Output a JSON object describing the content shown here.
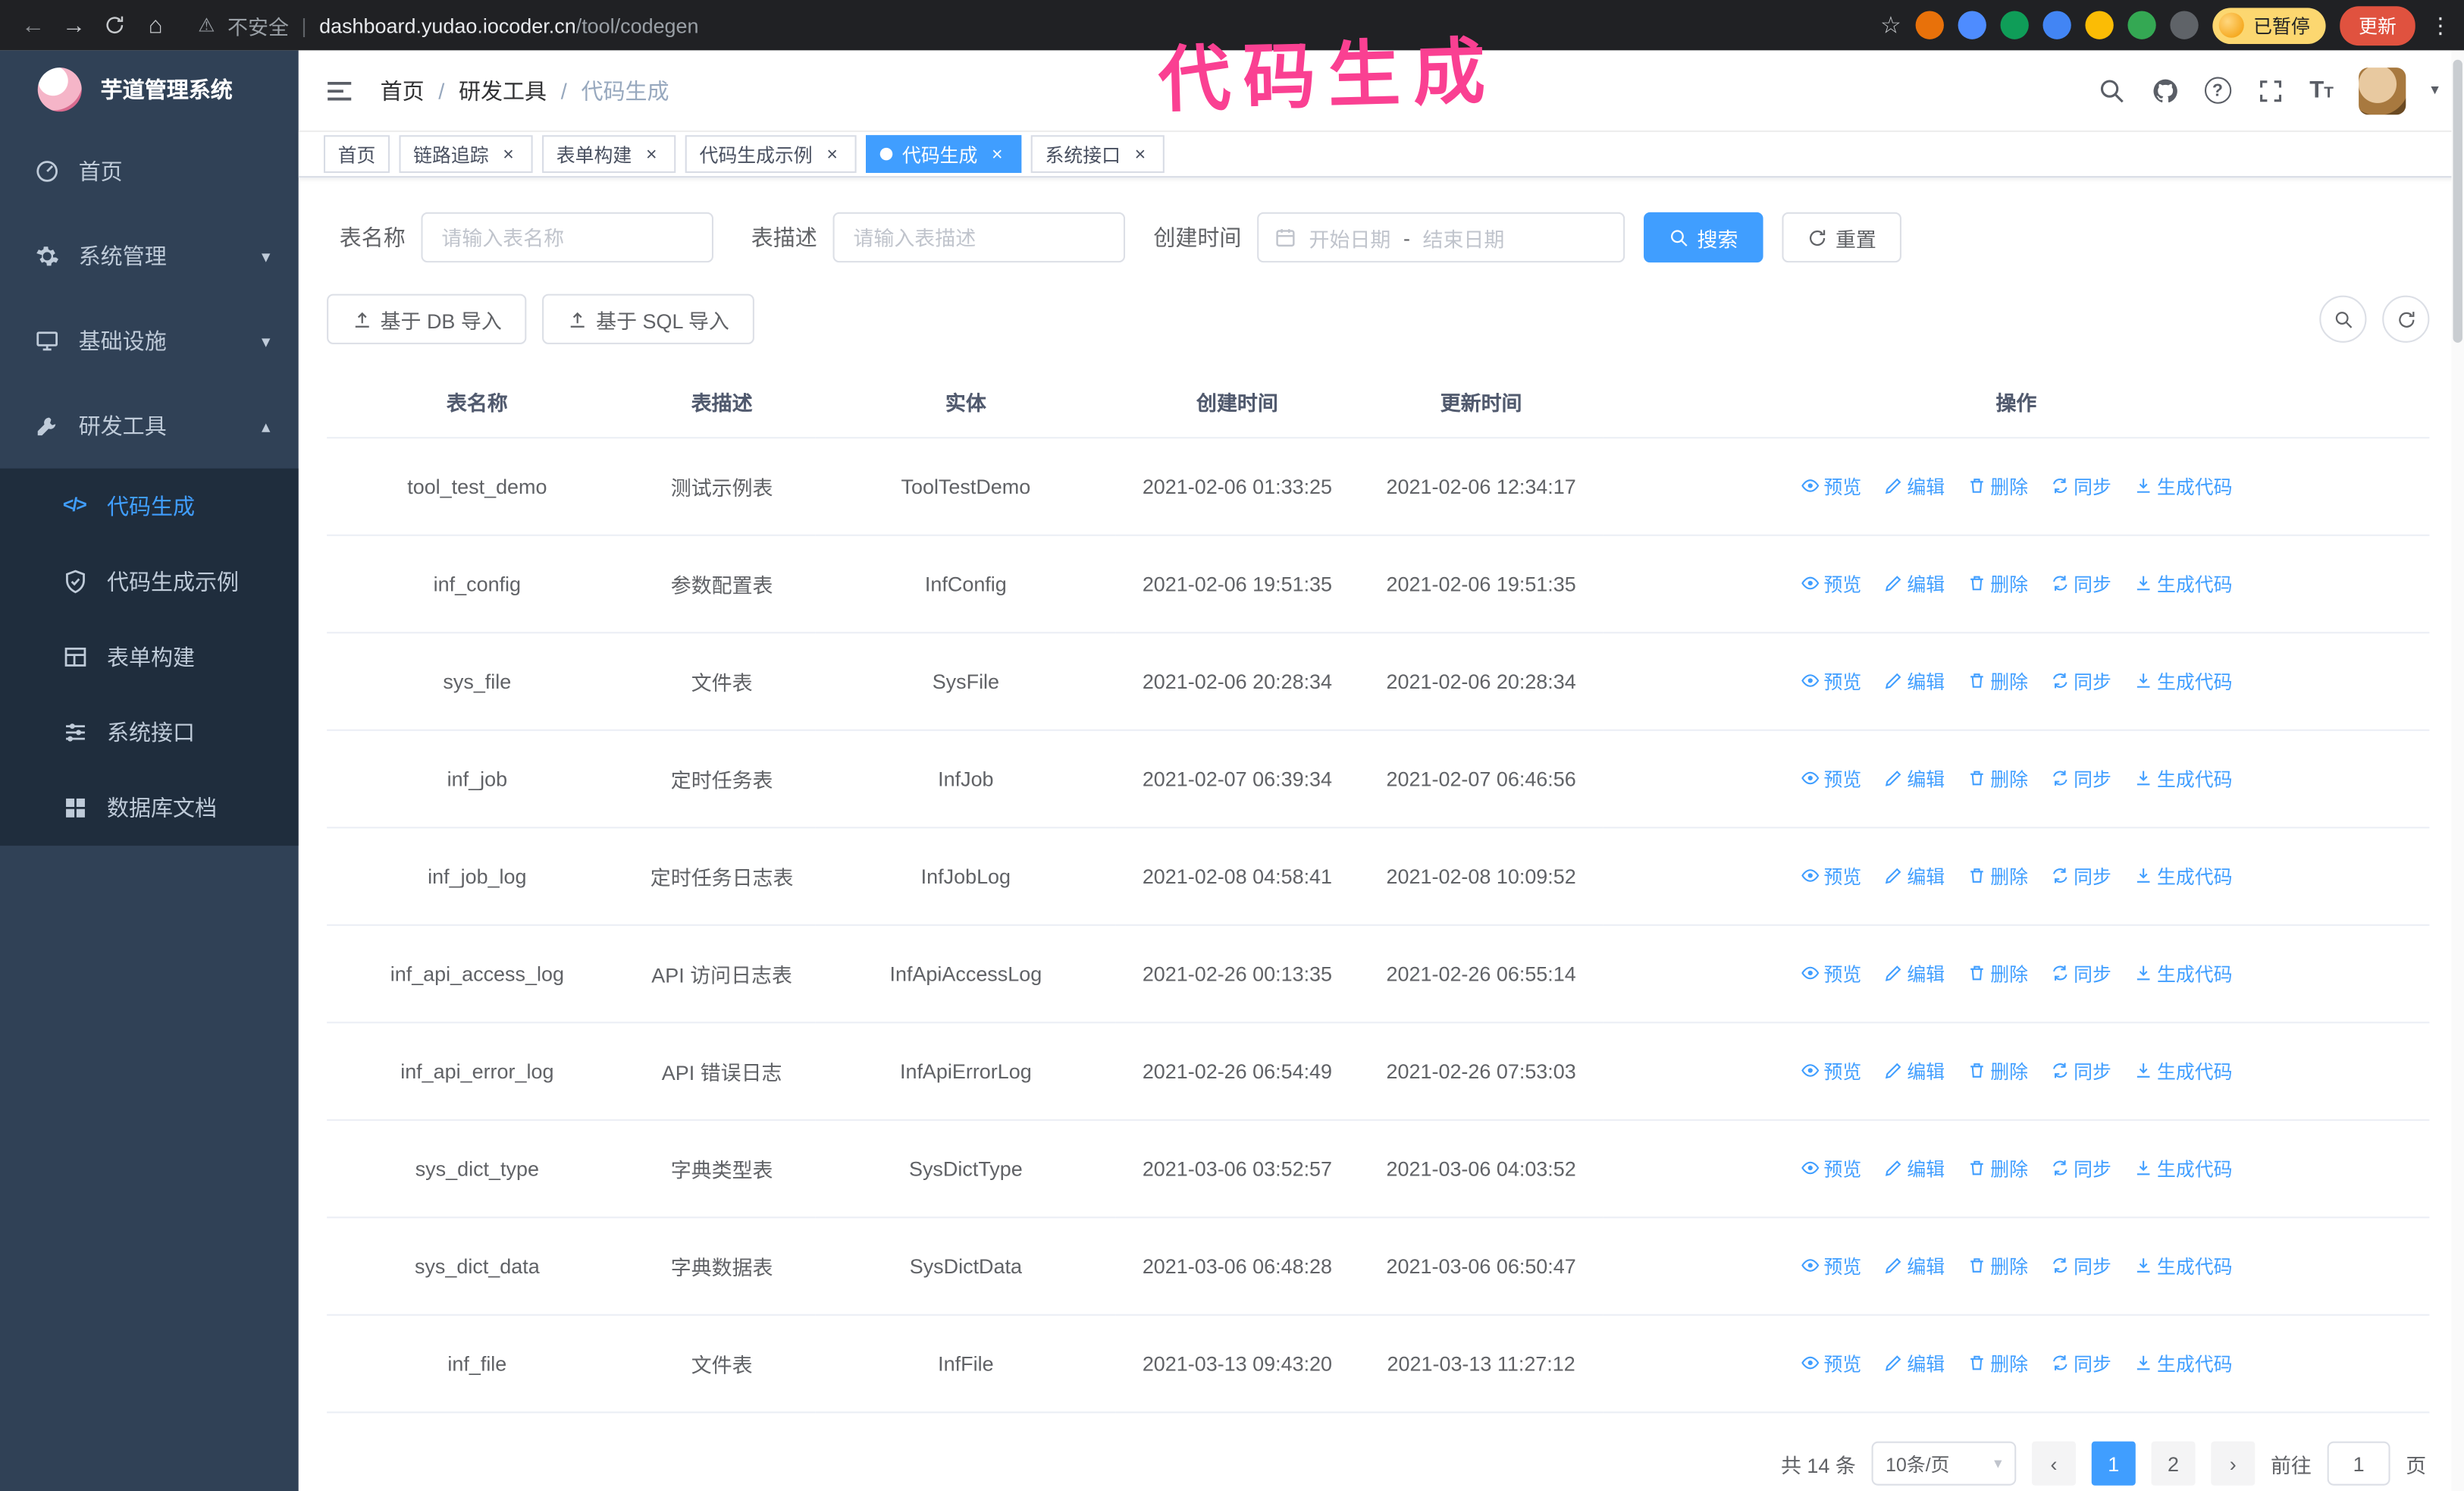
{
  "annotation": {
    "text": "代码生成"
  },
  "browser": {
    "security_label": "不安全",
    "url_host": "dashboard.yudao.iocoder.cn",
    "url_path": "/tool/codegen",
    "paused_badge": "已暂停",
    "update_button": "更新"
  },
  "sidebar": {
    "logo_title": "芋道管理系统",
    "items": [
      {
        "label": "首页"
      },
      {
        "label": "系统管理"
      },
      {
        "label": "基础设施"
      },
      {
        "label": "研发工具"
      }
    ],
    "submenu": [
      {
        "label": "代码生成",
        "active": true
      },
      {
        "label": "代码生成示例"
      },
      {
        "label": "表单构建"
      },
      {
        "label": "系统接口"
      },
      {
        "label": "数据库文档"
      }
    ]
  },
  "header": {
    "breadcrumb": [
      "首页",
      "研发工具",
      "代码生成"
    ],
    "separator": "/"
  },
  "tabs": [
    {
      "label": "首页",
      "closable": false
    },
    {
      "label": "链路追踪",
      "closable": true
    },
    {
      "label": "表单构建",
      "closable": true
    },
    {
      "label": "代码生成示例",
      "closable": true
    },
    {
      "label": "代码生成",
      "closable": true,
      "active": true
    },
    {
      "label": "系统接口",
      "closable": true
    }
  ],
  "filters": {
    "table_name_label": "表名称",
    "table_name_placeholder": "请输入表名称",
    "table_desc_label": "表描述",
    "table_desc_placeholder": "请输入表描述",
    "create_time_label": "创建时间",
    "date_start_placeholder": "开始日期",
    "date_separator": "-",
    "date_end_placeholder": "结束日期",
    "search_button": "搜索",
    "reset_button": "重置"
  },
  "toolbar": {
    "import_db_button": "基于 DB 导入",
    "import_sql_button": "基于 SQL 导入"
  },
  "table": {
    "columns": [
      "表名称",
      "表描述",
      "实体",
      "创建时间",
      "更新时间",
      "操作"
    ],
    "actions": [
      {
        "label": "预览",
        "name": "preview",
        "icon": "i-eye"
      },
      {
        "label": "编辑",
        "name": "edit",
        "icon": "i-edit"
      },
      {
        "label": "删除",
        "name": "delete",
        "icon": "i-trash"
      },
      {
        "label": "同步",
        "name": "sync",
        "icon": "i-sync"
      },
      {
        "label": "生成代码",
        "name": "generate-code",
        "icon": "i-download"
      }
    ],
    "rows": [
      {
        "name": "tool_test_demo",
        "desc": "测试示例表",
        "entity": "ToolTestDemo",
        "created": "2021-02-06 01:33:25",
        "updated": "2021-02-06 12:34:17"
      },
      {
        "name": "inf_config",
        "desc": "参数配置表",
        "entity": "InfConfig",
        "created": "2021-02-06 19:51:35",
        "updated": "2021-02-06 19:51:35"
      },
      {
        "name": "sys_file",
        "desc": "文件表",
        "entity": "SysFile",
        "created": "2021-02-06 20:28:34",
        "updated": "2021-02-06 20:28:34"
      },
      {
        "name": "inf_job",
        "desc": "定时任务表",
        "entity": "InfJob",
        "created": "2021-02-07 06:39:34",
        "updated": "2021-02-07 06:46:56"
      },
      {
        "name": "inf_job_log",
        "desc": "定时任务日志表",
        "entity": "InfJobLog",
        "created": "2021-02-08 04:58:41",
        "updated": "2021-02-08 10:09:52"
      },
      {
        "name": "inf_api_access_log",
        "desc": "API 访问日志表",
        "entity": "InfApiAccessLog",
        "created": "2021-02-26 00:13:35",
        "updated": "2021-02-26 06:55:14"
      },
      {
        "name": "inf_api_error_log",
        "desc": "API 错误日志",
        "entity": "InfApiErrorLog",
        "created": "2021-02-26 06:54:49",
        "updated": "2021-02-26 07:53:03"
      },
      {
        "name": "sys_dict_type",
        "desc": "字典类型表",
        "entity": "SysDictType",
        "created": "2021-03-06 03:52:57",
        "updated": "2021-03-06 04:03:52"
      },
      {
        "name": "sys_dict_data",
        "desc": "字典数据表",
        "entity": "SysDictData",
        "created": "2021-03-06 06:48:28",
        "updated": "2021-03-06 06:50:47"
      },
      {
        "name": "inf_file",
        "desc": "文件表",
        "entity": "InfFile",
        "created": "2021-03-13 09:43:20",
        "updated": "2021-03-13 11:27:12"
      }
    ]
  },
  "pagination": {
    "total": "共 14 条",
    "page_size": "10条/页",
    "pages": [
      "1",
      "2"
    ],
    "goto_label": "前往",
    "goto_value": "1",
    "page_label": "页"
  }
}
